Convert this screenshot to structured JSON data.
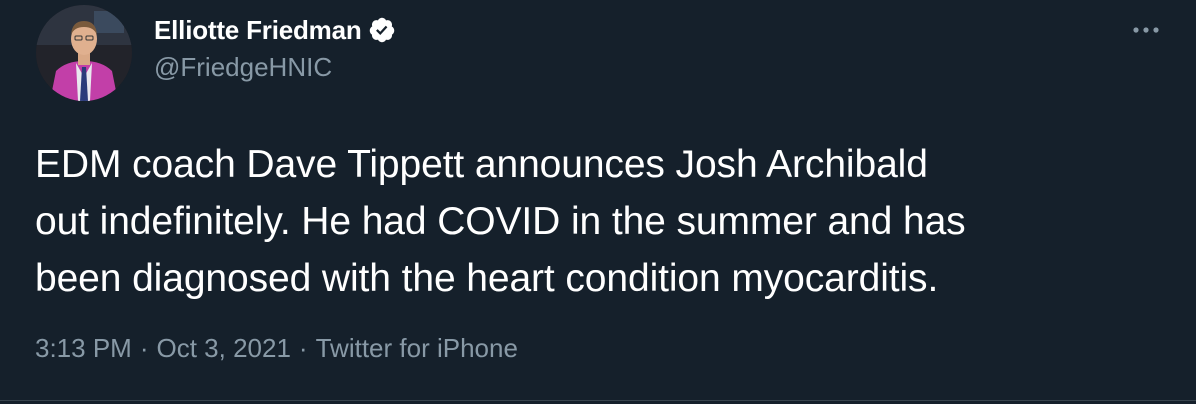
{
  "author": {
    "display_name": "Elliotte Friedman",
    "handle": "@FriedgeHNIC",
    "verified": true,
    "verified_icon": "verified-badge-icon"
  },
  "tweet": {
    "lines": [
      "EDM coach Dave Tippett announces Josh Archibald",
      "out indefinitely. He had COVID in the summer and has",
      "been diagnosed with the heart condition myocarditis."
    ]
  },
  "meta": {
    "time": "3:13 PM",
    "date": "Oct 3, 2021",
    "source": "Twitter for iPhone",
    "separator": "·"
  },
  "colors": {
    "background": "#15202b",
    "text_primary": "#ffffff",
    "text_secondary": "#8899a6",
    "verified_badge": "#ffffff"
  },
  "icons": {
    "more": "more-options-icon"
  }
}
